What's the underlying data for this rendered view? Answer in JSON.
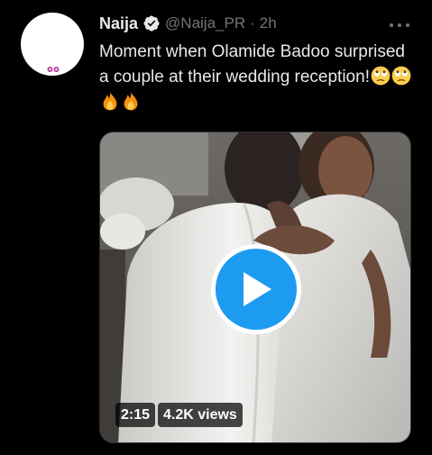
{
  "tweet": {
    "author": {
      "display_name": "Naija",
      "handle": "@Naija_PR",
      "verified_icon": "verified-badge-icon",
      "separator": "·",
      "time": "2h"
    },
    "text": "Moment when Olamide Badoo surprised a couple at their wedding reception!",
    "emojis": [
      "face-with-rolling-eyes-emoji",
      "face-with-rolling-eyes-emoji",
      "fire-emoji",
      "fire-emoji"
    ],
    "more_icon": "more-options-icon",
    "media": {
      "type": "video",
      "play_icon": "play-icon",
      "duration": "2:15",
      "views": "4.2K views"
    }
  },
  "colors": {
    "background": "#000000",
    "primary_text": "#e7e9ea",
    "secondary_text": "#71767b",
    "accent": "#1d9bf0"
  }
}
